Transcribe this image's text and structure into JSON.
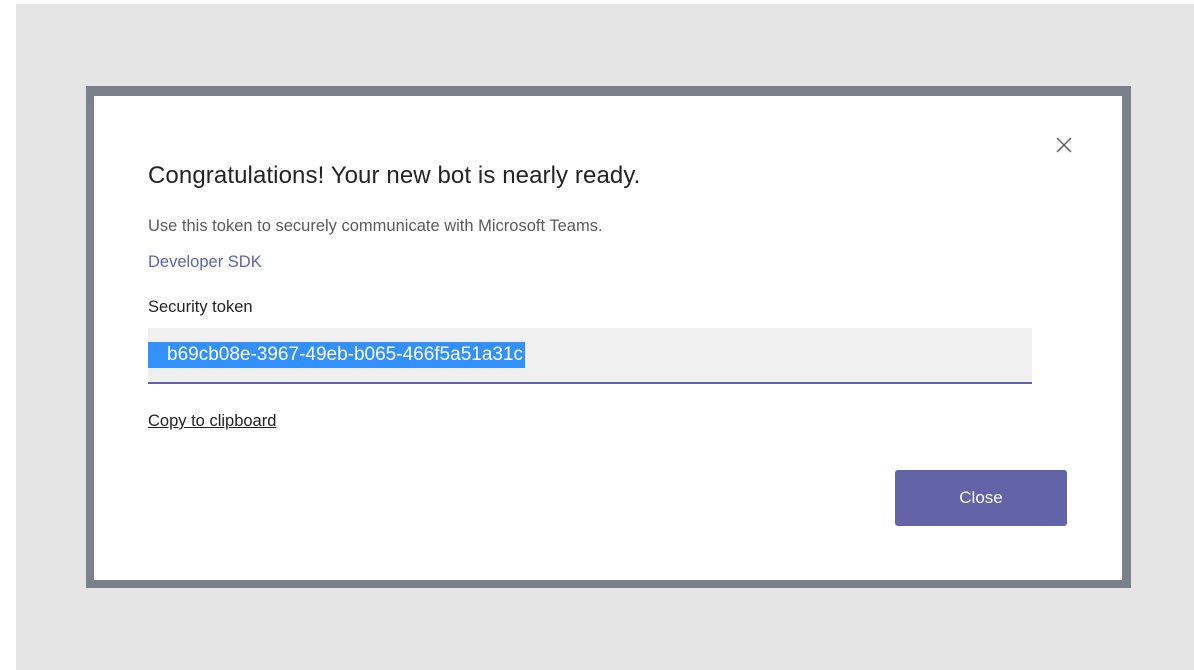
{
  "dialog": {
    "title": "Congratulations! Your new bot is nearly ready.",
    "description": "Use this token to securely communicate with Microsoft Teams.",
    "sdk_link": "Developer SDK",
    "token_label": "Security token",
    "token_value": "b69cb08e-3967-49eb-b065-466f5a51a31c",
    "copy_link": "Copy to clipboard",
    "close_button": "Close",
    "close_icon": "close-icon"
  },
  "colors": {
    "accent": "#6264a7",
    "selection": "#3390ff",
    "backdrop": "#e5e5e5",
    "frame": "#7c808a"
  }
}
